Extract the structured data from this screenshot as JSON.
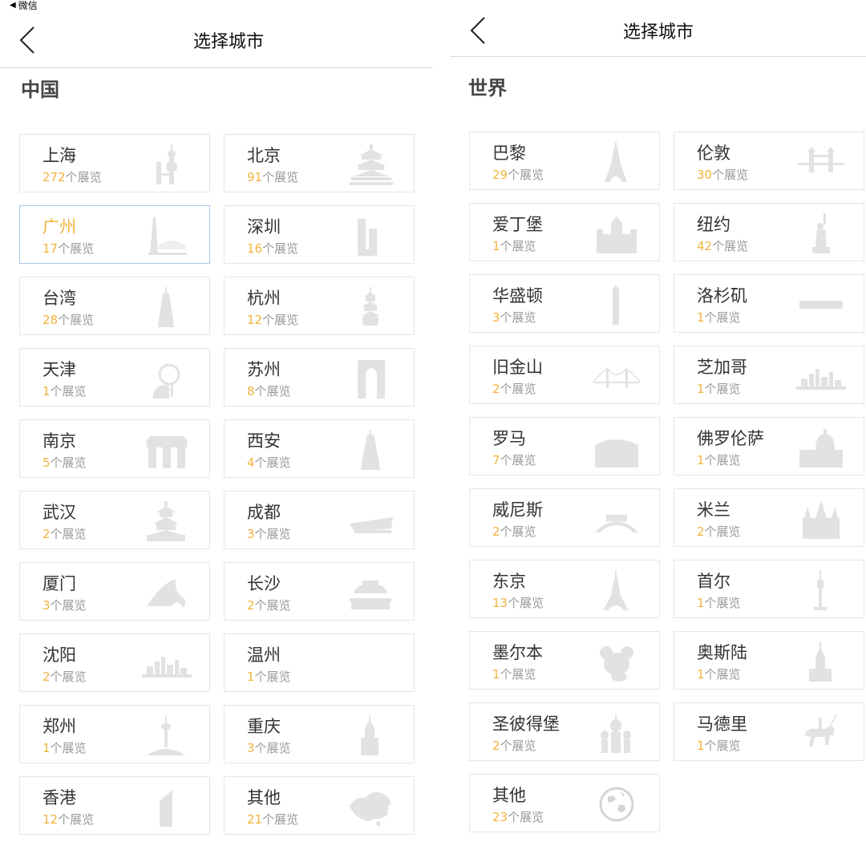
{
  "status_bar": {
    "carrier": "微信"
  },
  "accent_color": "#f2b33c",
  "left_screen": {
    "nav": {
      "back_icon": "chevron-left-icon",
      "title": "选择城市"
    },
    "region": "中国",
    "cities": [
      {
        "name": "上海",
        "count": "272",
        "unit": "个展览",
        "icon": "oriental-pearl-tower-icon"
      },
      {
        "name": "北京",
        "count": "91",
        "unit": "个展览",
        "icon": "temple-of-heaven-icon"
      },
      {
        "name": "广州",
        "count": "17",
        "unit": "个展览",
        "icon": "canton-tower-icon",
        "selected": true
      },
      {
        "name": "深圳",
        "count": "16",
        "unit": "个展览",
        "icon": "skyscraper-icon"
      },
      {
        "name": "台湾",
        "count": "28",
        "unit": "个展览",
        "icon": "taipei-101-icon"
      },
      {
        "name": "杭州",
        "count": "12",
        "unit": "个展览",
        "icon": "pagoda-icon"
      },
      {
        "name": "天津",
        "count": "1",
        "unit": "个展览",
        "icon": "ferris-wheel-icon"
      },
      {
        "name": "苏州",
        "count": "8",
        "unit": "个展览",
        "icon": "gate-of-orient-icon"
      },
      {
        "name": "南京",
        "count": "5",
        "unit": "个展览",
        "icon": "gate-building-icon"
      },
      {
        "name": "西安",
        "count": "4",
        "unit": "个展览",
        "icon": "giant-wild-goose-pagoda-icon"
      },
      {
        "name": "武汉",
        "count": "2",
        "unit": "个展览",
        "icon": "yellow-crane-tower-icon"
      },
      {
        "name": "成都",
        "count": "3",
        "unit": "个展览",
        "icon": "building-icon"
      },
      {
        "name": "厦门",
        "count": "3",
        "unit": "个展览",
        "icon": "wave-roof-icon"
      },
      {
        "name": "长沙",
        "count": "2",
        "unit": "个展览",
        "icon": "pavilion-icon"
      },
      {
        "name": "沈阳",
        "count": "2",
        "unit": "个展览",
        "icon": "skyline-icon"
      },
      {
        "name": "温州",
        "count": "1",
        "unit": "个展览",
        "icon": ""
      },
      {
        "name": "郑州",
        "count": "1",
        "unit": "个展览",
        "icon": "tv-tower-icon"
      },
      {
        "name": "重庆",
        "count": "3",
        "unit": "个展览",
        "icon": "church-icon"
      },
      {
        "name": "香港",
        "count": "12",
        "unit": "个展览",
        "icon": "bank-tower-icon"
      },
      {
        "name": "其他",
        "count": "21",
        "unit": "个展览",
        "icon": "china-map-icon"
      }
    ]
  },
  "right_screen": {
    "nav": {
      "back_icon": "chevron-left-icon",
      "title": "选择城市"
    },
    "region": "世界",
    "cities": [
      {
        "name": "巴黎",
        "count": "29",
        "unit": "个展览",
        "icon": "eiffel-tower-icon"
      },
      {
        "name": "伦敦",
        "count": "30",
        "unit": "个展览",
        "icon": "tower-bridge-icon"
      },
      {
        "name": "爱丁堡",
        "count": "1",
        "unit": "个展览",
        "icon": "castle-icon"
      },
      {
        "name": "纽约",
        "count": "42",
        "unit": "个展览",
        "icon": "statue-of-liberty-icon"
      },
      {
        "name": "华盛顿",
        "count": "3",
        "unit": "个展览",
        "icon": "obelisk-icon"
      },
      {
        "name": "洛杉矶",
        "count": "1",
        "unit": "个展览",
        "icon": "hollywood-sign-icon"
      },
      {
        "name": "旧金山",
        "count": "2",
        "unit": "个展览",
        "icon": "golden-gate-bridge-icon"
      },
      {
        "name": "芝加哥",
        "count": "1",
        "unit": "个展览",
        "icon": "skyline-icon"
      },
      {
        "name": "罗马",
        "count": "7",
        "unit": "个展览",
        "icon": "colosseum-icon"
      },
      {
        "name": "佛罗伦萨",
        "count": "1",
        "unit": "个展览",
        "icon": "duomo-icon"
      },
      {
        "name": "威尼斯",
        "count": "2",
        "unit": "个展览",
        "icon": "rialto-bridge-icon"
      },
      {
        "name": "米兰",
        "count": "2",
        "unit": "个展览",
        "icon": "milan-cathedral-icon"
      },
      {
        "name": "东京",
        "count": "13",
        "unit": "个展览",
        "icon": "tokyo-tower-icon"
      },
      {
        "name": "首尔",
        "count": "1",
        "unit": "个展览",
        "icon": "n-seoul-tower-icon"
      },
      {
        "name": "墨尔本",
        "count": "1",
        "unit": "个展览",
        "icon": "koala-icon"
      },
      {
        "name": "奥斯陆",
        "count": "1",
        "unit": "个展览",
        "icon": "chapel-icon"
      },
      {
        "name": "圣彼得堡",
        "count": "2",
        "unit": "个展览",
        "icon": "onion-dome-icon"
      },
      {
        "name": "马德里",
        "count": "1",
        "unit": "个展览",
        "icon": "horse-rider-icon"
      },
      {
        "name": "其他",
        "count": "23",
        "unit": "个展览",
        "icon": "globe-icon"
      }
    ]
  }
}
